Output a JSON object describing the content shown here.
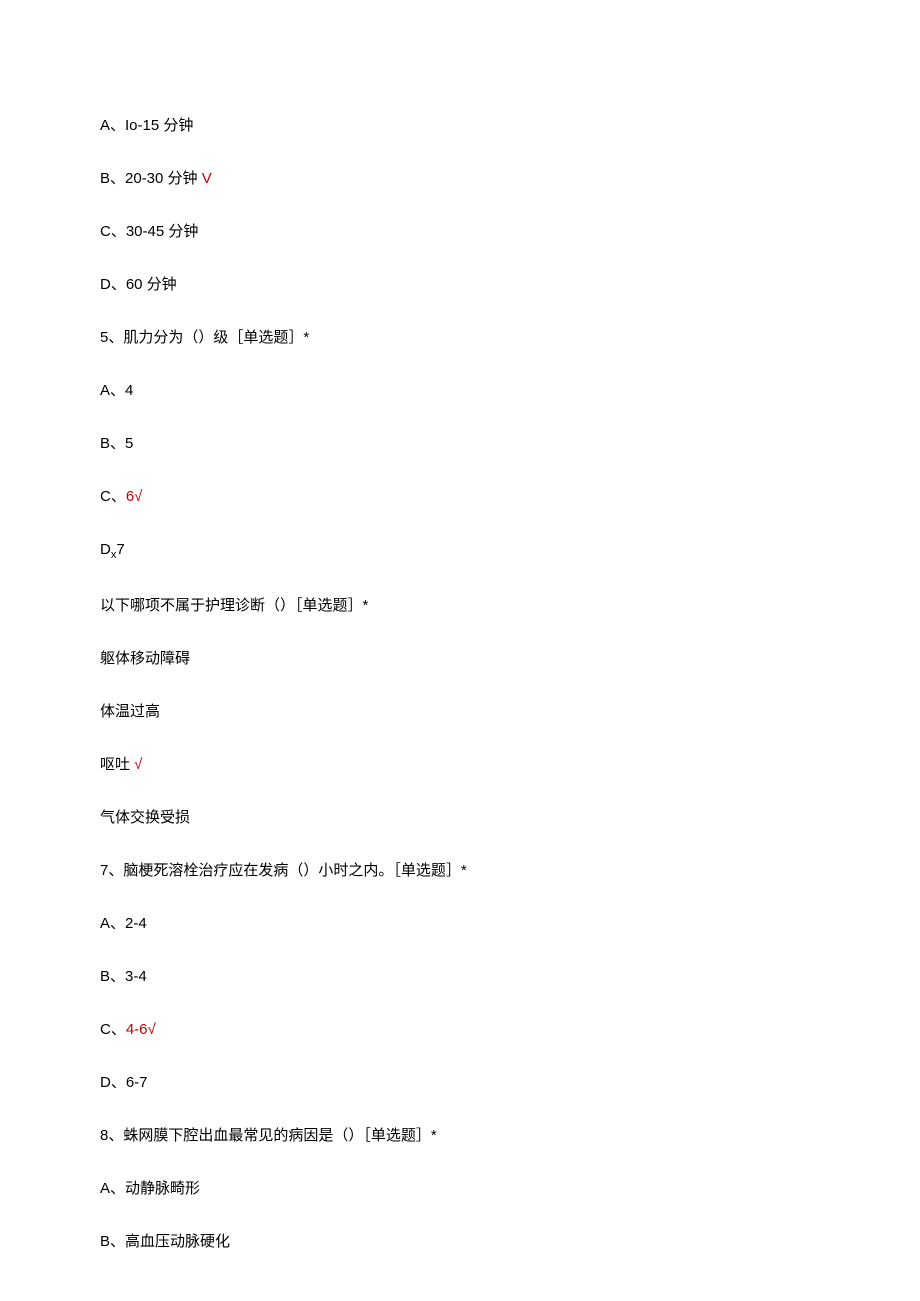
{
  "lines": {
    "l1": "A、Io-15 分钟",
    "l2a": "B、20-30 分钟 ",
    "l2b": "V",
    "l3": "C、30-45 分钟",
    "l4": "D、60 分钟",
    "l5": "5、肌力分为（）级［单选题］*",
    "l6": "A、4",
    "l7": "B、5",
    "l8a": "C、",
    "l8b": "6√",
    "l9a": "D",
    "l9b": "x",
    "l9c": "7",
    "l10": "以下哪项不属于护理诊断（）［单选题］*",
    "l11": "躯体移动障碍",
    "l12": "体温过高",
    "l13a": "呕吐 ",
    "l13b": "√",
    "l14": "气体交换受损",
    "l15": "7、脑梗死溶栓治疗应在发病（）小时之内。［单选题］*",
    "l16": "A、2-4",
    "l17": "B、3-4",
    "l18a": "C、",
    "l18b": "4-6√",
    "l19": "D、6-7",
    "l20": "8、蛛网膜下腔出血最常见的病因是（）［单选题］*",
    "l21": "A、动静脉畸形",
    "l22": "B、高血压动脉硬化"
  }
}
